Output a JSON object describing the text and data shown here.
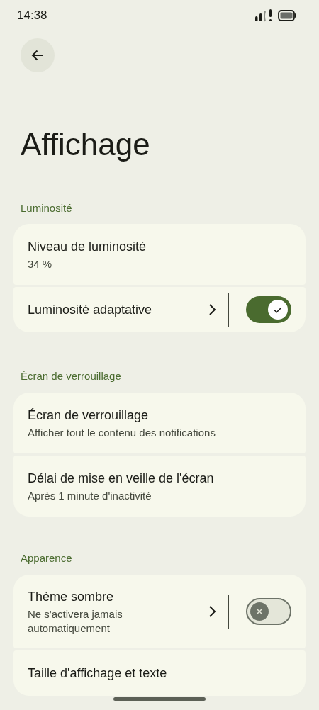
{
  "status_bar": {
    "time": "14:38"
  },
  "title": "Affichage",
  "sections": [
    {
      "header": "Luminosité",
      "items": [
        {
          "kind": "text",
          "title": "Niveau de luminosité",
          "summary": "34 %"
        },
        {
          "kind": "link_switch",
          "title": "Luminosité adaptative",
          "on": true
        }
      ]
    },
    {
      "header": "Écran de verrouillage",
      "items": [
        {
          "kind": "text",
          "title": "Écran de verrouillage",
          "summary": "Afficher tout le contenu des notifications"
        },
        {
          "kind": "text",
          "title": "Délai de mise en veille de l'écran",
          "summary": "Après 1 minute d'inactivité"
        }
      ]
    },
    {
      "header": "Apparence",
      "items": [
        {
          "kind": "link_switch",
          "title": "Thème sombre",
          "summary": "Ne s'activera jamais automatiquement",
          "on": false
        },
        {
          "kind": "text",
          "title": "Taille d'affichage et texte"
        }
      ]
    }
  ]
}
